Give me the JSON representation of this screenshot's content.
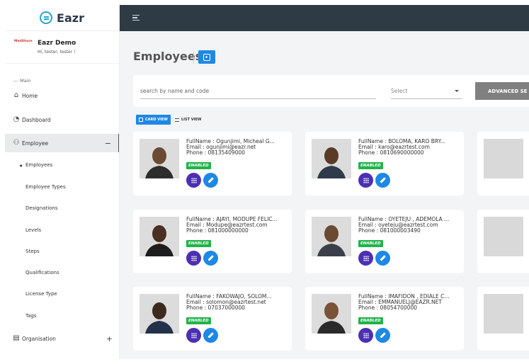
{
  "app": {
    "brand": "Eazr"
  },
  "profile": {
    "org_logo_text": "MedShure",
    "name": "Eazr Demo",
    "greeting": "Hi, tester, tester !"
  },
  "sidebar": {
    "section": "--- Main",
    "items": [
      {
        "label": "Home",
        "icon": "home-icon"
      },
      {
        "label": "Dashboard",
        "icon": "pie-chart-icon"
      },
      {
        "label": "Employee",
        "icon": "users-icon",
        "toggle": "−"
      },
      {
        "label": "Organisation",
        "icon": "building-icon",
        "toggle": "+"
      }
    ],
    "sub_items": [
      "Employees",
      "Employee Types",
      "Designations",
      "Levels",
      "Steps",
      "Qualifications",
      "License Type",
      "Tags"
    ]
  },
  "main": {
    "title": "Employees",
    "search_placeholder": "search by name and code",
    "select_placeholder": "Select",
    "advanced_button": "ADVANCED SE",
    "card_view_label": "CARD VIEW",
    "list_view_label": "LIST VIEW"
  },
  "employees": [
    {
      "fullname": "FullName : Ogunjimi, Micheal G...",
      "email": "Email : ogunjimi@eazr.net",
      "phone": "Phone : 08135409000",
      "status": "ENABLED"
    },
    {
      "fullname": "FullName : BOLOMA, KARO BRY...",
      "email": "Email : karo@eazrtest.com",
      "phone": "Phone : 0810690000000",
      "status": "ENABLED"
    },
    {
      "fullname": "FullName : AJAYI, MODUPE FELIC...",
      "email": "Email : Modupe@eazrtest.com",
      "phone": "Phone : 081000000000",
      "status": "ENABLED"
    },
    {
      "fullname": "FullName : OYETEJU , ADEMOLA ...",
      "email": "Email : oyeteju@eazrtest.com",
      "phone": "Phone : 081000003490",
      "status": "ENABLED"
    },
    {
      "fullname": "FullName : FAKOWAJO, SOLOM...",
      "email": "Email : solomon@eazrtest.net",
      "phone": "Phone : 07037000000",
      "status": "ENABLED"
    },
    {
      "fullname": "FullName : IMAFIDON , EDIALE C...",
      "email": "Email : EMMANUELJ@EAZR.NET",
      "phone": "Phone : 08054700000",
      "status": "ENABLED"
    }
  ]
}
